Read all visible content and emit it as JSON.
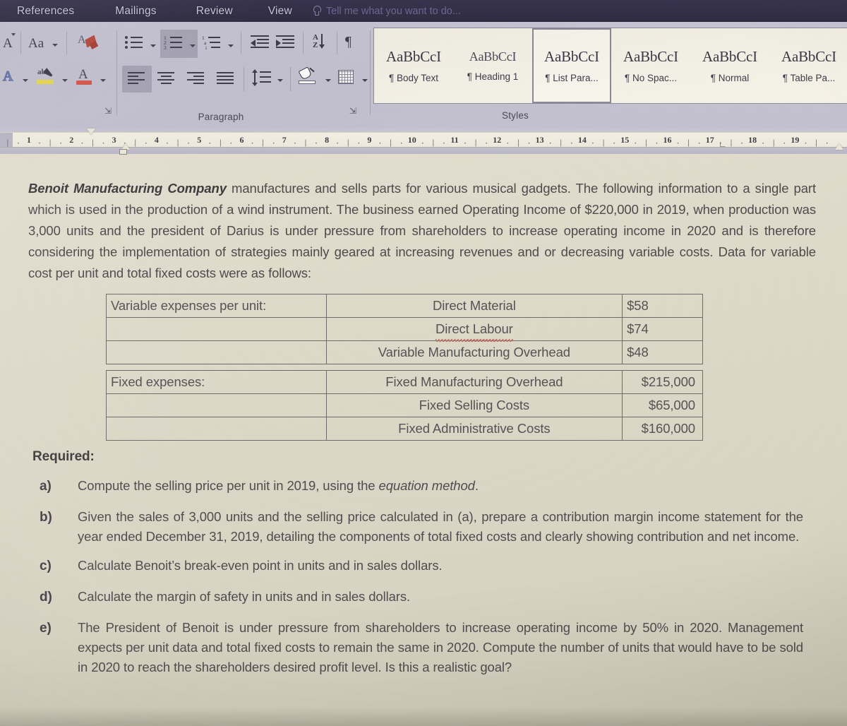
{
  "ribbon": {
    "tabs": [
      {
        "label": "References"
      },
      {
        "label": "Mailings"
      },
      {
        "label": "Review"
      },
      {
        "label": "View"
      }
    ],
    "tell_me": "Tell me what you want to do...",
    "groups": {
      "font": {
        "label": ""
      },
      "paragraph": {
        "label": "Paragraph"
      },
      "styles": {
        "label": "Styles"
      }
    },
    "style_gallery": [
      {
        "preview": "AaBbCcI",
        "name": "¶ Body Text",
        "selected": false
      },
      {
        "preview": "AaBbCcI",
        "name": "¶ Heading 1",
        "selected": false
      },
      {
        "preview": "AaBbCcI",
        "name": "¶ List Para...",
        "selected": true
      },
      {
        "preview": "AaBbCcI",
        "name": "¶ No Spac...",
        "selected": false
      },
      {
        "preview": "AaBbCcI",
        "name": "¶ Normal",
        "selected": false
      },
      {
        "preview": "AaBbCcI",
        "name": "¶ Table Pa...",
        "selected": false
      }
    ],
    "font_group_buttons": [
      "shrink-font",
      "change-case",
      "format-painter",
      "text-effects",
      "text-highlight-color",
      "font-color"
    ],
    "paragraph_group_buttons": [
      "bullets",
      "numbering",
      "multilevel-list",
      "decrease-indent",
      "increase-indent",
      "sort",
      "show-formatting-marks",
      "align-left",
      "align-center",
      "align-right",
      "justify",
      "line-spacing",
      "shading",
      "borders"
    ]
  },
  "ruler": {
    "numbers": [
      "1",
      "2",
      "3",
      "4",
      "5",
      "6",
      "7",
      "8",
      "9",
      "10",
      "11",
      "12",
      "13",
      "14",
      "15",
      "16",
      "17",
      "18",
      "19"
    ]
  },
  "document": {
    "paragraph_lead_bold": "Benoit Manufacturing Company",
    "paragraph_rest": " manufactures and sells parts for various musical gadgets. The following information to a single part which is used in the production of a wind instrument. The business earned Operating Income of $220,000 in 2019, when production was 3,000 units and the president of Darius is under pressure from shareholders to increase operating income in 2020 and is therefore considering the implementation of strategies mainly geared at increasing revenues and or decreasing variable costs. Data for variable cost per unit and total fixed costs were as follows:",
    "table": {
      "rows": [
        {
          "c1": "Variable expenses per unit:",
          "c2": "Direct Material",
          "c3": "$58",
          "align": "left",
          "spell_error": false
        },
        {
          "c1": "",
          "c2": "Direct Labour",
          "c3": "$74",
          "align": "left",
          "spell_error": true
        },
        {
          "c1": "",
          "c2": "Variable Manufacturing Overhead",
          "c3": "$48",
          "align": "left",
          "spell_error": false
        },
        {
          "c1": "Fixed expenses:",
          "c2": "Fixed Manufacturing Overhead",
          "c3": "$215,000",
          "align": "right",
          "spell_error": false
        },
        {
          "c1": "",
          "c2": "Fixed Selling Costs",
          "c3": "$65,000",
          "align": "right",
          "spell_error": false
        },
        {
          "c1": "",
          "c2": "Fixed Administrative Costs",
          "c3": "$160,000",
          "align": "right",
          "spell_error": false
        }
      ]
    },
    "required_heading": "Required:",
    "questions": [
      {
        "label": "a)",
        "text_before": "Compute the selling price per unit in 2019, using the ",
        "text_italic": "equation method",
        "text_after": "."
      },
      {
        "label": "b)",
        "text_before": "Given the sales of 3,000 units and the selling price calculated in (a), prepare a contribution margin income statement for the year ended December 31, 2019, detailing the components of total fixed costs and clearly showing contribution and net income.",
        "text_italic": "",
        "text_after": ""
      },
      {
        "label": "c)",
        "text_before": "Calculate Benoit’s break-even point in units and in sales dollars.",
        "text_italic": "",
        "text_after": ""
      },
      {
        "label": "d)",
        "text_before": "Calculate the margin of safety in units and in sales dollars.",
        "text_italic": "",
        "text_after": ""
      },
      {
        "label": "e)",
        "text_before": "The President of Benoit is under pressure from shareholders to increase operating income by 50% in 2020. Management expects per unit data and total fixed costs to remain the same in 2020. Compute the number of units that would have to be sold in 2020 to reach the shareholders desired profit level. Is this a realistic goal?",
        "text_italic": "",
        "text_after": ""
      }
    ]
  },
  "colors": {
    "ribbon_tabbar": "#343048",
    "ribbon_body": "#c5c3d1",
    "document_bg": "#ded9ca",
    "text": "#4d4b4c",
    "spell_error": "#c0554e",
    "highlight_yellow": "#e8d84a",
    "font_color_red": "#d5564a"
  }
}
